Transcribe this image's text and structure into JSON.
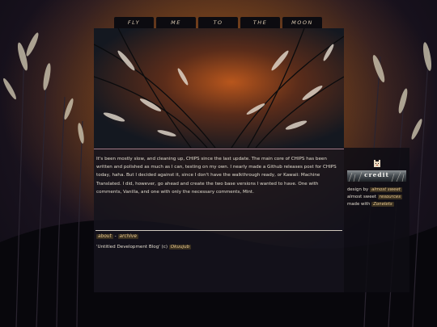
{
  "nav": {
    "items": [
      "FLY",
      "ME",
      "TO",
      "THE",
      "MOON"
    ]
  },
  "post": {
    "body": "It's been mostly slow, and cleaning up, CHIPS since the last update. The main core of CHIPS has been written and polished as much as I can, testing on my own. I nearly made a Github releases post for CHIPS today, haha. But I decided against it, since I don't have the walkthrough ready, or Kawaii: Machine Translated. I did, however, go ahead and create the two base versions I wanted to have. One with comments, Vanilla, and one with only the necessary comments, Mint.",
    "about_link": "about",
    "separator": "-",
    "archive_link": "archive"
  },
  "footer": {
    "text": "'Untitled Development Blog' (c)",
    "author": "Okuujub"
  },
  "sidebar": {
    "credit_title": "credit",
    "design_by_text": "design by",
    "design_by_link": "almost sweet",
    "resources_prefix": "almost sweet",
    "resources_link": "resources",
    "made_with_text": "made with",
    "made_with_link": "Zonelets"
  },
  "colors": {
    "panel": "#14131c",
    "link_chip_bg": "#3a3020",
    "link_chip_text": "#e8c890",
    "text": "#e2dccf",
    "banner_line": "#9c7a8a"
  }
}
